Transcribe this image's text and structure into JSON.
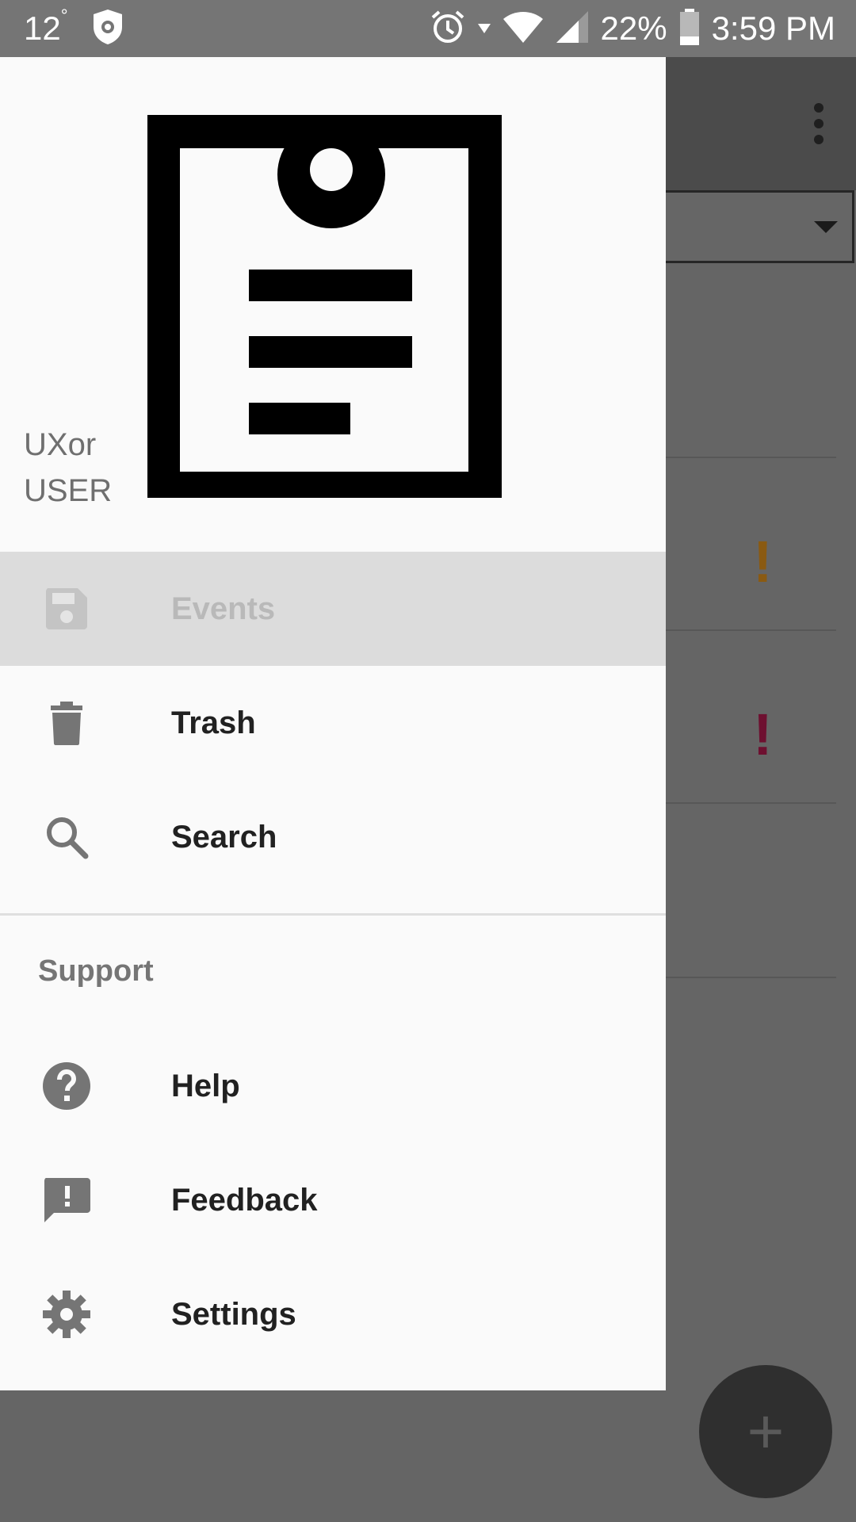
{
  "status_bar": {
    "temperature": "12",
    "degree": "°",
    "battery": "22%",
    "time": "3:59 PM"
  },
  "drawer": {
    "user_line1": "UXor",
    "user_line2": "USER",
    "items": [
      {
        "label": "Events",
        "icon": "save-icon",
        "active": true
      },
      {
        "label": "Trash",
        "icon": "trash-icon",
        "active": false
      },
      {
        "label": "Search",
        "icon": "search-icon",
        "active": false
      }
    ],
    "support_header": "Support",
    "support_items": [
      {
        "label": "Help",
        "icon": "help-icon"
      },
      {
        "label": "Feedback",
        "icon": "feedback-icon"
      },
      {
        "label": "Settings",
        "icon": "settings-icon"
      }
    ]
  },
  "background_app": {
    "fab_symbol": "+",
    "priority_marks": [
      "!",
      "!"
    ],
    "priority_colors": [
      "#8a5a12",
      "#6e1030"
    ]
  },
  "colors": {
    "drawer_bg": "#fafafa",
    "active_item_bg": "#dcdcdc",
    "status_bar": "#757575",
    "scrim": "#656565"
  }
}
